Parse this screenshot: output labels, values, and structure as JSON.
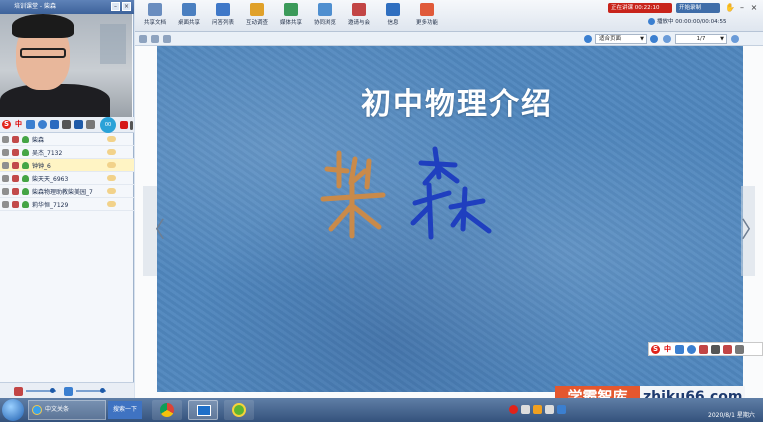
{
  "window": {
    "title": "培训课堂 - 柴森"
  },
  "left_panel": {
    "users": [
      {
        "name": "柴森",
        "selected": false
      },
      {
        "name": "吴杰_7132",
        "selected": false
      },
      {
        "name": "钟钟_6",
        "selected": true
      },
      {
        "name": "柴天天_6963",
        "selected": false
      },
      {
        "name": "柴森物理助教柴美园_7",
        "selected": false
      },
      {
        "name": "莉华恒_7129",
        "selected": false
      }
    ]
  },
  "toolbar": {
    "tools": [
      {
        "label": "共享文档",
        "icon": "document-icon",
        "color": "#6a8dbf"
      },
      {
        "label": "桌面共享",
        "icon": "desktop-share-icon",
        "color": "#4a7fc0"
      },
      {
        "label": "问答列表",
        "icon": "qa-list-icon",
        "color": "#3f78c8"
      },
      {
        "label": "互动调查",
        "icon": "survey-icon",
        "color": "#e0a12a"
      },
      {
        "label": "媒体共享",
        "icon": "media-share-icon",
        "color": "#3b9a5a"
      },
      {
        "label": "协同浏览",
        "icon": "co-browse-icon",
        "color": "#4f8fd0"
      },
      {
        "label": "邀请与会",
        "icon": "invite-icon",
        "color": "#c24545"
      },
      {
        "label": "信息",
        "icon": "info-icon",
        "color": "#2f6fc0"
      },
      {
        "label": "更多功能",
        "icon": "more-icon",
        "color": "#e05a3a"
      }
    ],
    "live_status": "正在讲课 00:22:10",
    "record_label": "开始录制",
    "playback": "播放中 00:00:00/00:04:55"
  },
  "subbar": {
    "fit_option": "适合页面",
    "page_indicator": "1/7"
  },
  "slide": {
    "title": "初中物理介绍"
  },
  "watermark": {
    "left_text": "学霸智库",
    "right_text": "zhiku66.com"
  },
  "taskbar": {
    "ie_task": "中文关条",
    "search_label": "搜索一下",
    "date": "2020/8/1 星期六"
  },
  "colors": {
    "slide_bg": "#4f86bd",
    "handwriting_orange": "#c98a4a",
    "handwriting_blue": "#1f3fbf",
    "live_red": "#c8241b"
  }
}
